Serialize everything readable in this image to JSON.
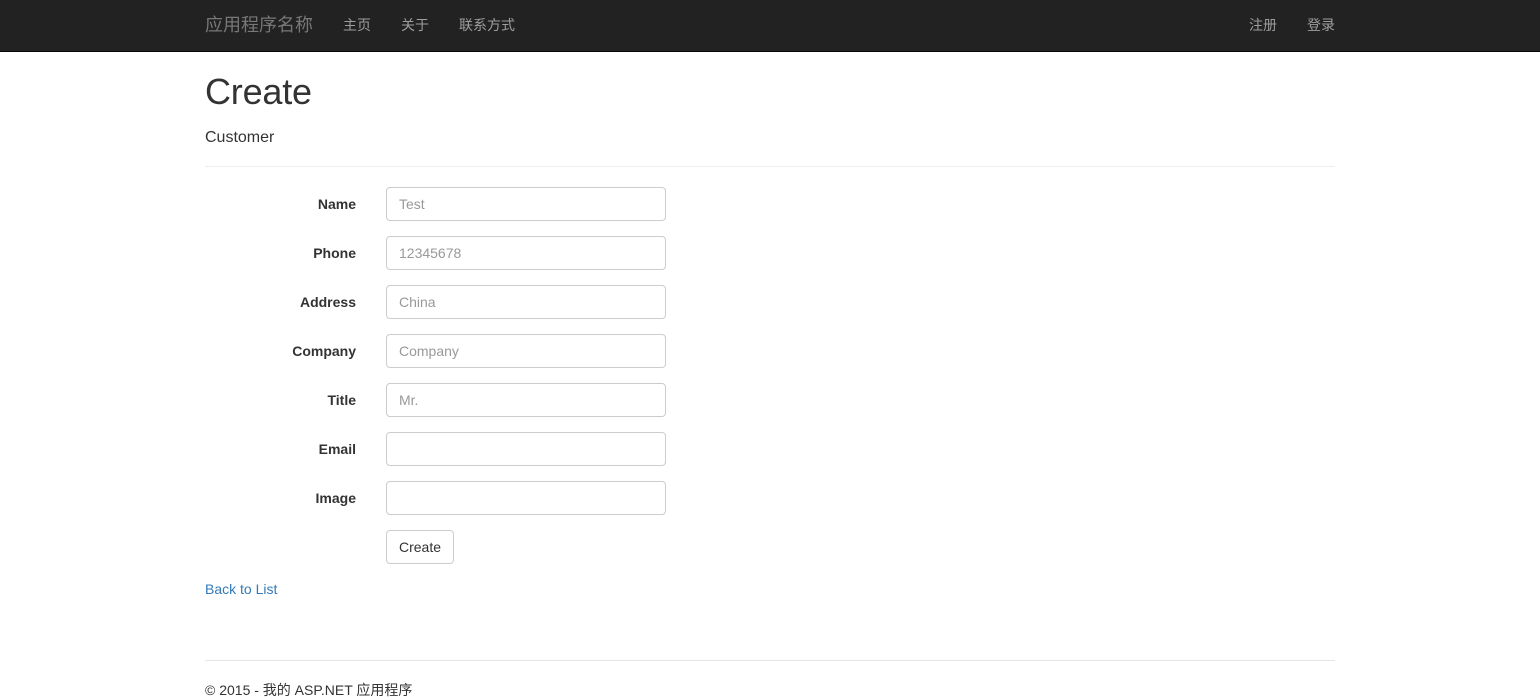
{
  "navbar": {
    "brand": "应用程序名称",
    "left_links": [
      {
        "label": "主页",
        "name": "nav-link-home"
      },
      {
        "label": "关于",
        "name": "nav-link-about"
      },
      {
        "label": "联系方式",
        "name": "nav-link-contact"
      }
    ],
    "right_links": [
      {
        "label": "注册",
        "name": "nav-link-register"
      },
      {
        "label": "登录",
        "name": "nav-link-login"
      }
    ],
    "background_color": "#222222",
    "link_color": "#9d9d9d",
    "brand_color": "#777777"
  },
  "page": {
    "title": "Create",
    "subtitle": "Customer"
  },
  "form": {
    "fields": [
      {
        "label": "Name",
        "value": "",
        "placeholder": "Test"
      },
      {
        "label": "Phone",
        "value": "",
        "placeholder": "12345678"
      },
      {
        "label": "Address",
        "value": "",
        "placeholder": "China"
      },
      {
        "label": "Company",
        "value": "",
        "placeholder": "Company"
      },
      {
        "label": "Title",
        "value": "",
        "placeholder": "Mr."
      },
      {
        "label": "Email",
        "value": "",
        "placeholder": ""
      },
      {
        "label": "Image",
        "value": "",
        "placeholder": ""
      }
    ],
    "submit_label": "Create",
    "back_link_label": "Back to List",
    "link_color": "#337ab7"
  },
  "footer": {
    "copyright": "© 2015 - 我的 ASP.NET 应用程序"
  }
}
